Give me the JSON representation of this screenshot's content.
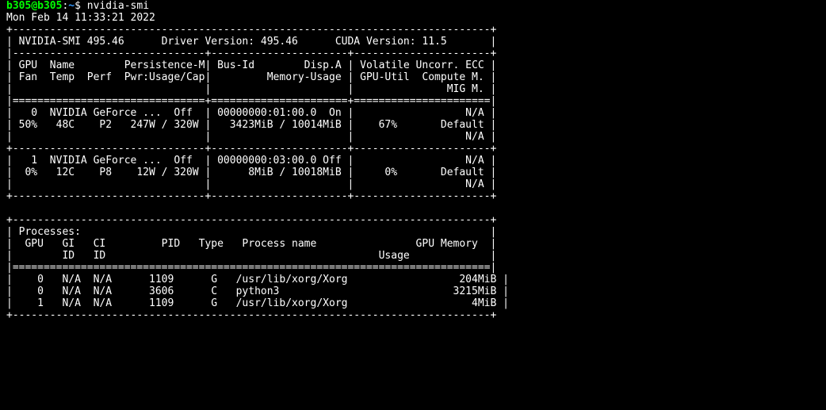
{
  "prompt": {
    "user": "b305",
    "host": "b305",
    "cwd": "~",
    "symbol": "$",
    "command": "nvidia-smi"
  },
  "timestamp": "Mon Feb 14 11:33:21 2022",
  "header": {
    "smi_version_label": "NVIDIA-SMI",
    "smi_version": "495.46",
    "driver_label": "Driver Version:",
    "driver_version": "495.46",
    "cuda_label": "CUDA Version:",
    "cuda_version": "11.5"
  },
  "column_labels": {
    "gpu": "GPU",
    "name": "Name",
    "persist": "Persistence-M",
    "fan": "Fan",
    "temp": "Temp",
    "perf": "Perf",
    "pwr": "Pwr:Usage/Cap",
    "busid": "Bus-Id",
    "dispa": "Disp.A",
    "memusage": "Memory-Usage",
    "volatile": "Volatile",
    "uncorr_ecc": "Uncorr. ECC",
    "gpu_util": "GPU-Util",
    "compute_m": "Compute M.",
    "mig_m": "MIG M."
  },
  "gpus": [
    {
      "index": "0",
      "name": "NVIDIA GeForce ...",
      "persistence": "Off",
      "bus_id": "00000000:01:00.0",
      "disp_a": "On",
      "ecc": "N/A",
      "fan": "50%",
      "temp": "48C",
      "perf": "P2",
      "pwr_usage": "247W",
      "pwr_cap": "320W",
      "mem_used": "3423MiB",
      "mem_total": "10014MiB",
      "gpu_util": "67%",
      "compute_mode": "Default",
      "mig_mode": "N/A"
    },
    {
      "index": "1",
      "name": "NVIDIA GeForce ...",
      "persistence": "Off",
      "bus_id": "00000000:03:00.0",
      "disp_a": "Off",
      "ecc": "N/A",
      "fan": "0%",
      "temp": "12C",
      "perf": "P8",
      "pwr_usage": "12W",
      "pwr_cap": "320W",
      "mem_used": "8MiB",
      "mem_total": "10018MiB",
      "gpu_util": "0%",
      "compute_mode": "Default",
      "mig_mode": "N/A"
    }
  ],
  "processes_header": "Processes:",
  "proc_labels": {
    "gpu": "GPU",
    "gi": "GI",
    "ci": "CI",
    "id": "ID",
    "pid": "PID",
    "type": "Type",
    "name": "Process name",
    "mem": "GPU Memory",
    "usage": "Usage"
  },
  "processes": [
    {
      "gpu": "0",
      "gi": "N/A",
      "ci": "N/A",
      "pid": "1109",
      "type": "G",
      "name": "/usr/lib/xorg/Xorg",
      "mem": "204MiB"
    },
    {
      "gpu": "0",
      "gi": "N/A",
      "ci": "N/A",
      "pid": "3606",
      "type": "C",
      "name": "python3",
      "mem": "3215MiB"
    },
    {
      "gpu": "1",
      "gi": "N/A",
      "ci": "N/A",
      "pid": "1109",
      "type": "G",
      "name": "/usr/lib/xorg/Xorg",
      "mem": "4MiB"
    }
  ]
}
